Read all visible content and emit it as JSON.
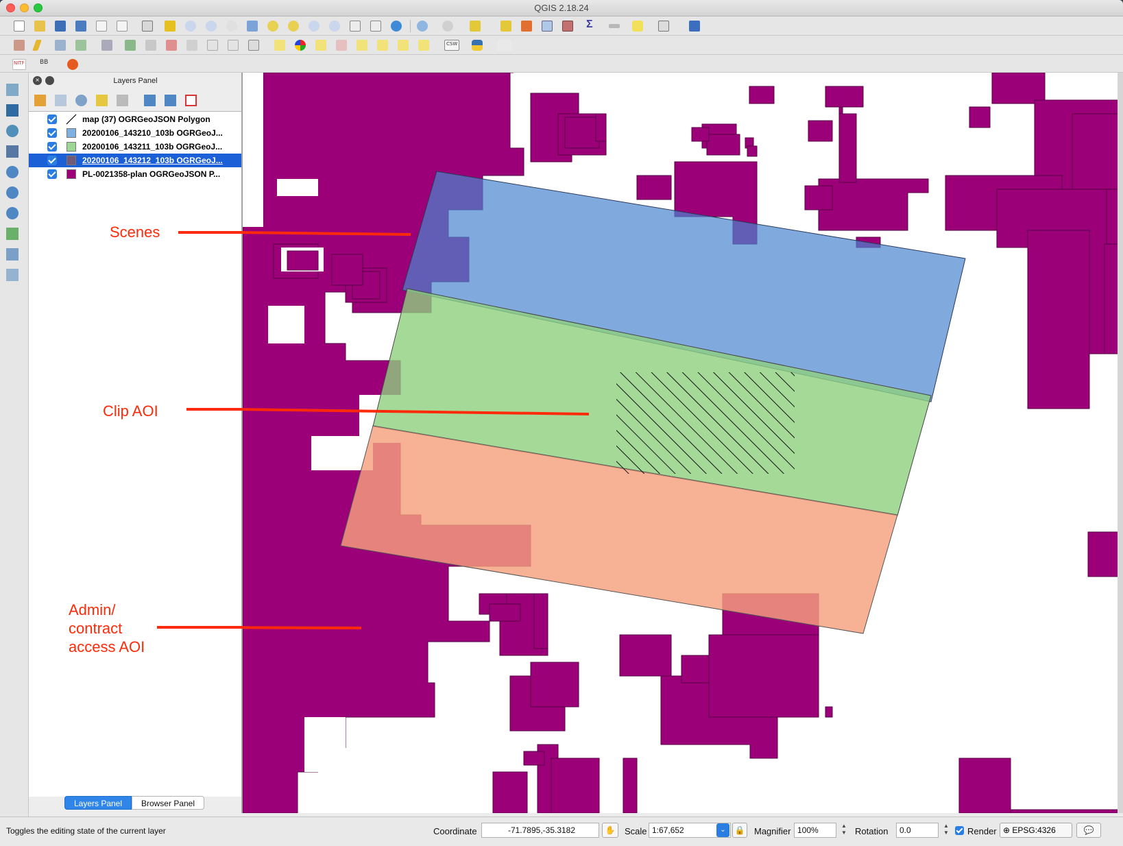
{
  "app": {
    "title": "QGIS 2.18.24"
  },
  "layers_panel": {
    "title": "Layers Panel",
    "layers": [
      {
        "name": "map (37) OGRGeoJSON Polygon",
        "checked": true,
        "symbol": "line",
        "color": "#000000",
        "selected": false
      },
      {
        "name": "20200106_143210_103b OGRGeoJ...",
        "checked": true,
        "symbol": "fill",
        "color": "#80b0e0",
        "selected": false
      },
      {
        "name": "20200106_143211_103b OGRGeoJ...",
        "checked": true,
        "symbol": "fill",
        "color": "#9ed696",
        "selected": false
      },
      {
        "name": "20200106_143212_103b OGRGeoJ...",
        "checked": true,
        "symbol": "fill",
        "color": "#705a78",
        "selected": true
      },
      {
        "name": "PL-0021358-plan OGRGeoJSON P...",
        "checked": true,
        "symbol": "fill",
        "color": "#9e0078",
        "selected": false
      }
    ],
    "tabs": {
      "layers": "Layers Panel",
      "browser": "Browser Panel"
    }
  },
  "toolbar3": {
    "nitf": "NITF",
    "bb": "BB",
    "csw": "CSW"
  },
  "annotations": {
    "scenes": "Scenes",
    "clip_aoi": "Clip AOI",
    "admin_line1": "Admin/",
    "admin_line2": "contract",
    "admin_line3": "access AOI"
  },
  "map_colors": {
    "admin": "#9b0078",
    "scene_blue": "#80b0e0",
    "scene_green": "#9ed696",
    "scene_orange": "#f4a57f",
    "annotation": "#ff2a0a"
  },
  "statusbar": {
    "message": "Toggles the editing state of the current layer",
    "coordinate_label": "Coordinate",
    "coordinate_value": "-71.7895,-35.3182",
    "scale_label": "Scale",
    "scale_value": "1:67,652",
    "magnifier_label": "Magnifier",
    "magnifier_value": "100%",
    "rotation_label": "Rotation",
    "rotation_value": "0.0",
    "render_label": "Render",
    "render_checked": true,
    "crs": "EPSG:4326"
  }
}
